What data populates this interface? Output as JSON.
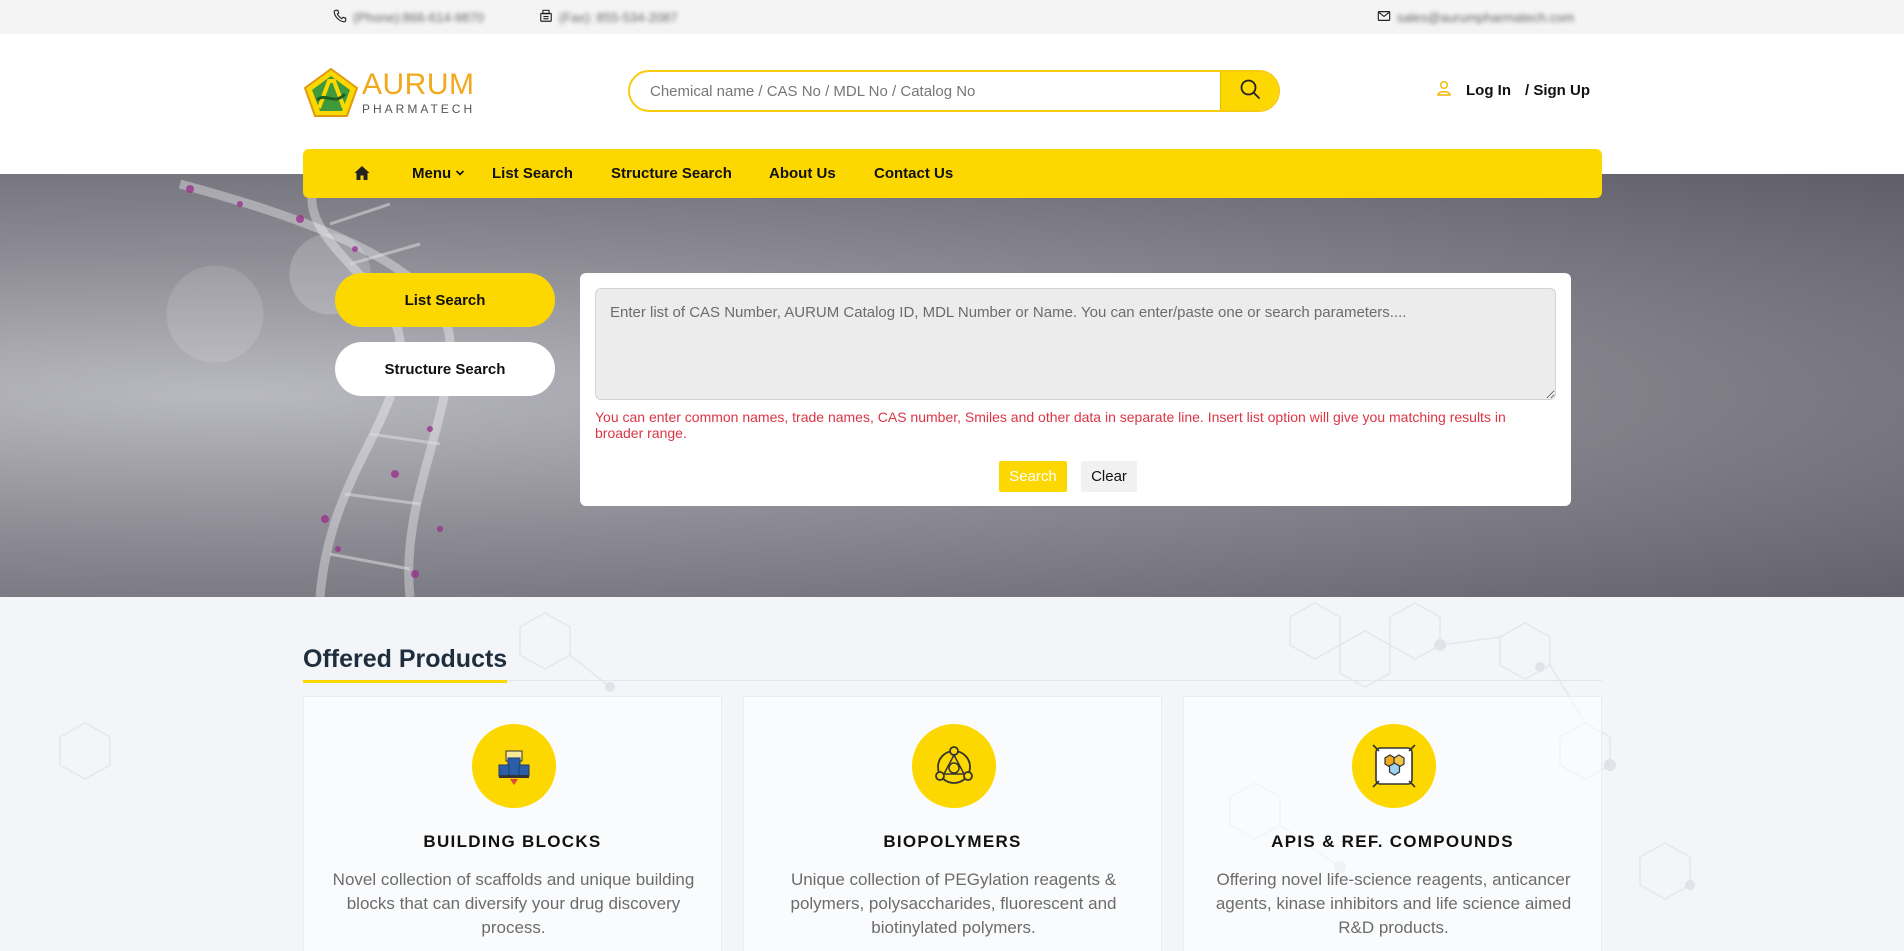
{
  "topbar": {
    "phone": "(Phone):866-614-9870",
    "fax": "(Fax): 855-534-2087",
    "email": "sales@aurumpharmatech.com"
  },
  "header": {
    "logo_brand": "AURUM",
    "logo_sub": "PHARMATECH",
    "search_placeholder": "Chemical name / CAS No / MDL No / Catalog No",
    "login_label": "Log In",
    "signup_label": "/ Sign Up"
  },
  "nav": {
    "items": [
      {
        "label": "Menu"
      },
      {
        "label": "List Search"
      },
      {
        "label": "Structure Search"
      },
      {
        "label": "About Us"
      },
      {
        "label": "Contact Us"
      }
    ]
  },
  "hero": {
    "tabs": [
      {
        "label": "List Search",
        "active": true
      },
      {
        "label": "Structure Search",
        "active": false
      }
    ],
    "textarea_placeholder": "Enter list of CAS Number, AURUM Catalog ID, MDL Number or Name. You can enter/paste one or search parameters....",
    "hint": "You can enter common names, trade names, CAS number, Smiles and other data in separate line. Insert list option will give you matching results in broader range.",
    "search_button": "Search",
    "clear_button": "Clear"
  },
  "offered": {
    "title": "Offered Products",
    "cards": [
      {
        "title": "BUILDING BLOCKS",
        "description": "Novel collection of scaffolds and unique building blocks that can diversify your drug discovery process.",
        "icon": "building-blocks-icon"
      },
      {
        "title": "BIOPOLYMERS",
        "description": "Unique collection of PEGylation reagents & polymers, polysaccharides, fluorescent and biotinylated polymers.",
        "icon": "biopolymers-icon"
      },
      {
        "title": "APIS & REF. COMPOUNDS",
        "description": "Offering novel life-science reagents, anticancer agents, kinase inhibitors and life science aimed R&D products.",
        "icon": "apis-icon"
      }
    ]
  },
  "colors": {
    "accent": "#fdd800",
    "logo_orange": "#f2a81c",
    "hint_red": "#dc3545"
  }
}
